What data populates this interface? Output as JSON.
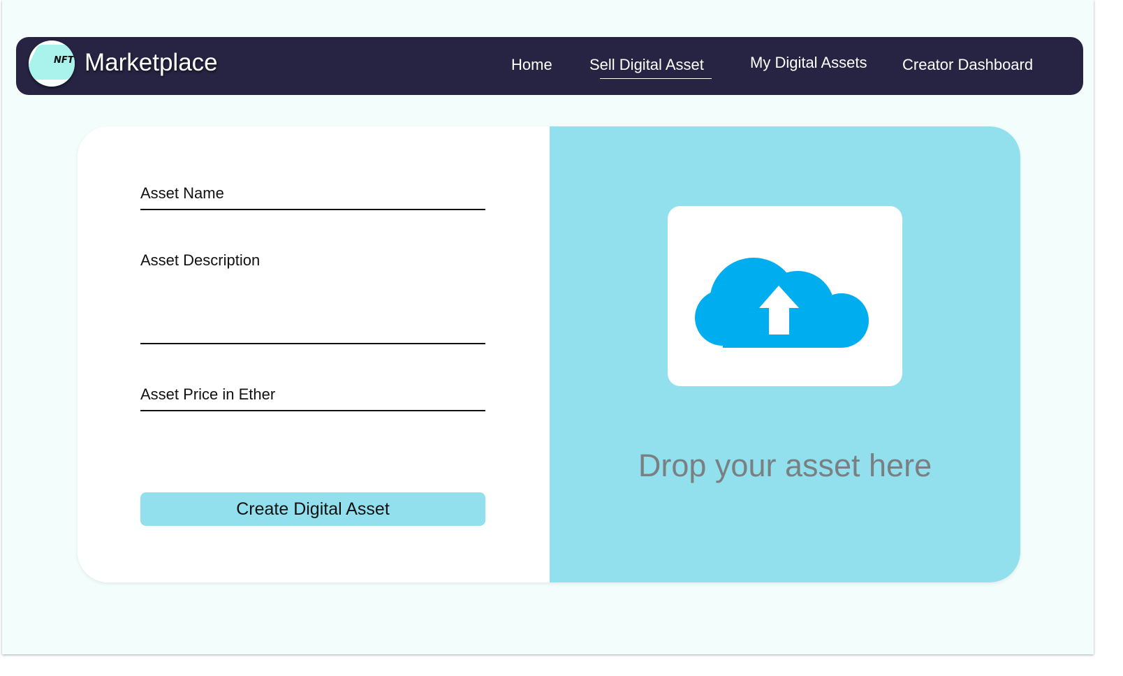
{
  "navbar": {
    "logo_text": "NFT",
    "brand": "Marketplace",
    "links": [
      {
        "label": "Home",
        "active": false
      },
      {
        "label": "Sell Digital Asset",
        "active": true
      },
      {
        "label": "My Digital Assets",
        "active": false
      },
      {
        "label": "Creator Dashboard",
        "active": false
      }
    ]
  },
  "form": {
    "name_placeholder": "Asset Name",
    "description_placeholder": "Asset Description",
    "price_placeholder": "Asset Price in Ether",
    "submit_label": "Create Digital Asset"
  },
  "dropzone": {
    "icon": "cloud-upload-icon",
    "text": "Drop your asset here"
  },
  "colors": {
    "navbar_bg": "#262442",
    "page_bg": "#f3fefc",
    "accent": "#92e0ee",
    "cloud": "#00aeef",
    "drop_text": "#7a7f82"
  }
}
